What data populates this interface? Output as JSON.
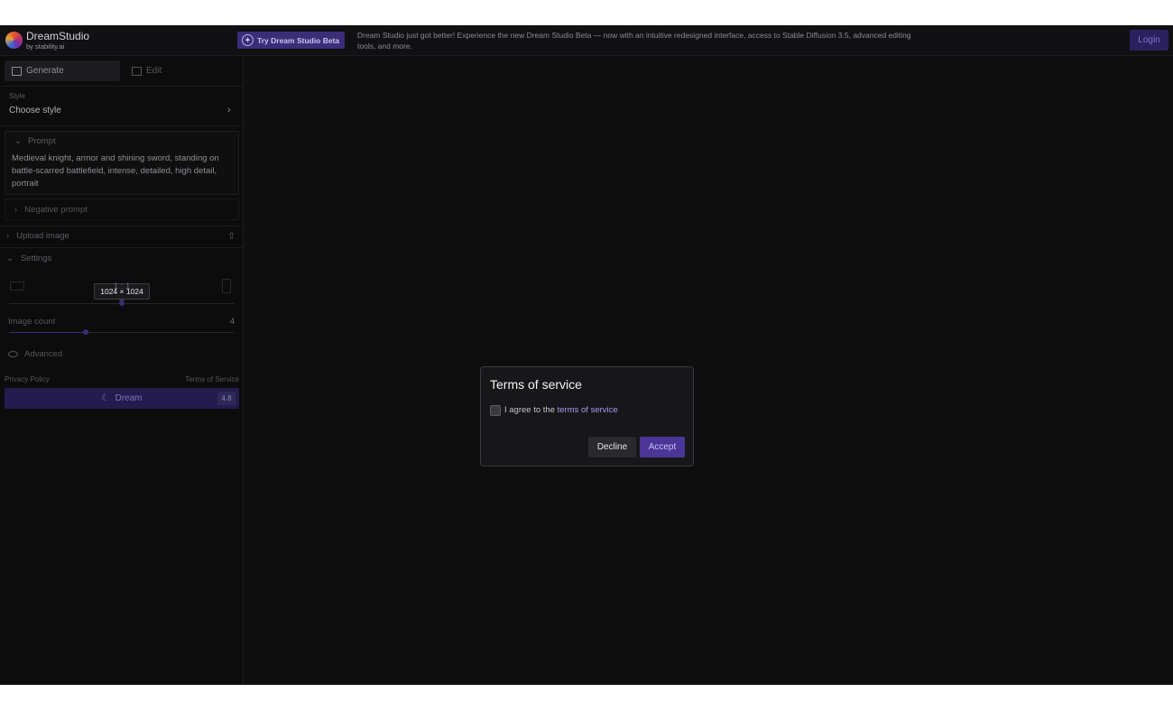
{
  "header": {
    "brand_name": "DreamStudio",
    "brand_sub": "by stability.ai",
    "beta_button": "Try Dream Studio Beta",
    "announcement": "Dream Studio just got better! Experience the new Dream Studio Beta — now with an intuitive redesigned interface, access to Stable Diffusion 3.5, advanced editing tools, and more.",
    "login": "Login"
  },
  "sidebar": {
    "tabs": [
      {
        "label": "Generate"
      },
      {
        "label": "Edit"
      }
    ],
    "style": {
      "label": "Style",
      "value": "Choose style"
    },
    "prompt": {
      "label": "Prompt",
      "text": "Medieval knight, armor and shining sword, standing on battle-scarred battlefield, intense, detailed, high detail, portrait"
    },
    "negative_prompt": "Negative prompt",
    "upload_image": "Upload image",
    "settings": {
      "label": "Settings",
      "dimensions_tooltip": "1024 × 1024",
      "aspect_ratio": "1 : 1",
      "aspect_slider_fraction": 0.5,
      "image_count_label": "Image count",
      "image_count_value": "4",
      "image_count_fraction": 0.34
    },
    "advanced": "Advanced",
    "privacy_policy": "Privacy Policy",
    "terms_of_service": "Terms of Service",
    "dream_button": "Dream",
    "dream_cost": "4.8"
  },
  "modal": {
    "title": "Terms of service",
    "agree_prefix": "I agree to the",
    "agree_link": "terms of service",
    "decline": "Decline",
    "accept": "Accept"
  },
  "colors": {
    "accent": "#4b3596",
    "background": "#0e0e0f"
  }
}
